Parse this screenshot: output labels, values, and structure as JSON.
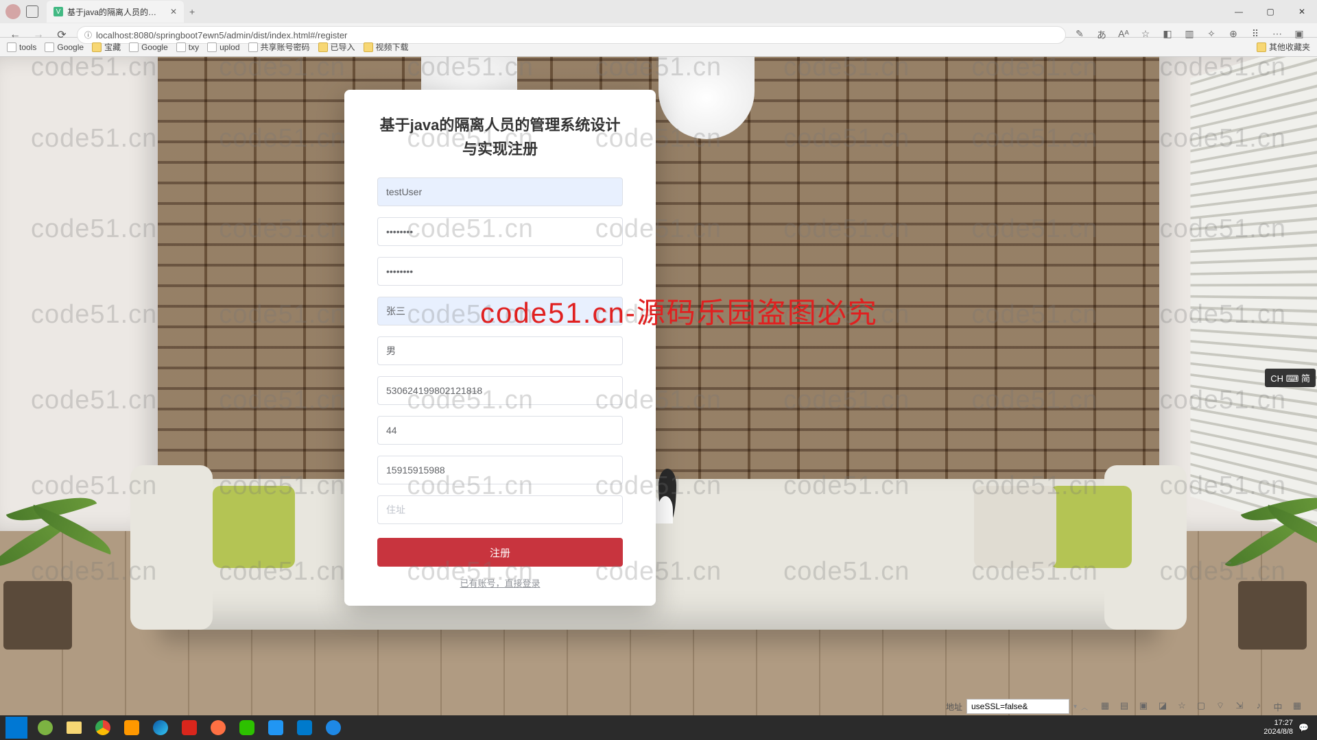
{
  "browser": {
    "tab_title": "基于java的隔离人员的管理系统设",
    "url": "localhost:8080/springboot7ewn5/admin/dist/index.html#/register",
    "bookmarks": [
      "tools",
      "Google",
      "宝藏",
      "Google",
      "txy",
      "uplod",
      "共享账号密码",
      "已导入",
      "视频下载"
    ],
    "other_bookmarks": "其他收藏夹"
  },
  "watermark": {
    "text": "code51.cn",
    "big_text": "code51.cn-源码乐园盗图必究"
  },
  "register": {
    "title": "基于java的隔离人员的管理系统设计与实现注册",
    "username": "testUser",
    "password1": "••••••••",
    "password2": "••••••••",
    "realname": "张三",
    "gender": "男",
    "idcard": "530624199802121818",
    "age": "44",
    "phone": "15915915988",
    "address_placeholder": "住址",
    "submit_label": "注册",
    "login_link": "已有账号，直接登录"
  },
  "ime": {
    "label": "CH ⌨ 简"
  },
  "status": {
    "label": "地址",
    "value": "useSSL=false&"
  },
  "taskbar": {
    "time": "17:27",
    "date": "2024/8/8"
  }
}
